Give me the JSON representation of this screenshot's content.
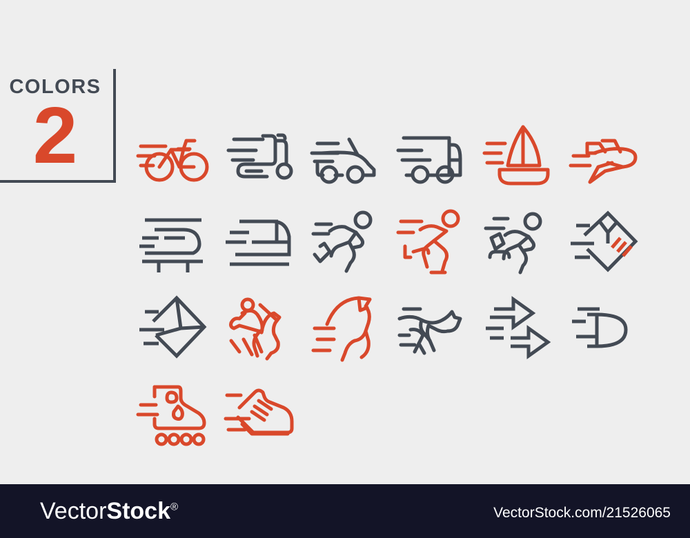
{
  "badge": {
    "word": "COLORS",
    "count": "2",
    "dark_color": "#434a54",
    "accent_color": "#d9482b"
  },
  "canvas": {
    "background_color": "#eeeeee",
    "width": "1000",
    "height": "780"
  },
  "icons": [
    {
      "name": "bicycle-icon",
      "label": "Bicycle",
      "color": "red",
      "row": 1,
      "col": 1
    },
    {
      "name": "scooter-icon",
      "label": "Scooter",
      "color": "dark",
      "row": 1,
      "col": 2
    },
    {
      "name": "car-icon",
      "label": "Car",
      "color": "dark",
      "row": 1,
      "col": 3
    },
    {
      "name": "delivery-truck-icon",
      "label": "Delivery Truck",
      "color": "dark",
      "row": 1,
      "col": 4
    },
    {
      "name": "sailboat-icon",
      "label": "Sailboat",
      "color": "red",
      "row": 1,
      "col": 5
    },
    {
      "name": "airplane-icon",
      "label": "Airplane",
      "color": "red",
      "row": 1,
      "col": 6
    },
    {
      "name": "train-icon",
      "label": "Speed Train",
      "color": "dark",
      "row": 2,
      "col": 1
    },
    {
      "name": "bullet-train-icon",
      "label": "Bullet Train",
      "color": "dark",
      "row": 2,
      "col": 2
    },
    {
      "name": "runner-icon",
      "label": "Runner",
      "color": "dark",
      "row": 2,
      "col": 3
    },
    {
      "name": "sprinter-icon",
      "label": "Sprinter",
      "color": "red",
      "row": 2,
      "col": 4
    },
    {
      "name": "courier-runner-icon",
      "label": "Courier Runner",
      "color": "dark",
      "row": 2,
      "col": 5
    },
    {
      "name": "parcel-icon",
      "label": "Express Parcel",
      "color": "dark",
      "row": 2,
      "col": 6
    },
    {
      "name": "envelope-icon",
      "label": "Express Mail",
      "color": "dark",
      "row": 2,
      "col": 7
    },
    {
      "name": "horse-racing-icon",
      "label": "Horse Racing",
      "color": "red",
      "row": 3,
      "col": 1
    },
    {
      "name": "horse-head-icon",
      "label": "Horse",
      "color": "red",
      "row": 3,
      "col": 2
    },
    {
      "name": "cheetah-icon",
      "label": "Cheetah",
      "color": "dark",
      "row": 3,
      "col": 3
    },
    {
      "name": "arrows-icon",
      "label": "Fast Arrows",
      "color": "dark",
      "row": 3,
      "col": 4
    },
    {
      "name": "comet-icon",
      "label": "Comet",
      "color": "dark",
      "row": 3,
      "col": 5
    },
    {
      "name": "roller-skate-icon",
      "label": "Roller Skate",
      "color": "red",
      "row": 3,
      "col": 6
    },
    {
      "name": "running-shoe-icon",
      "label": "Running Shoe",
      "color": "red",
      "row": 3,
      "col": 7
    }
  ],
  "watermark": {
    "brand_first": "Vector",
    "brand_second": "Stock",
    "registered": "®",
    "url": "VectorStock.com/21526065",
    "background_color": "#131427",
    "text_color": "#ffffff"
  }
}
